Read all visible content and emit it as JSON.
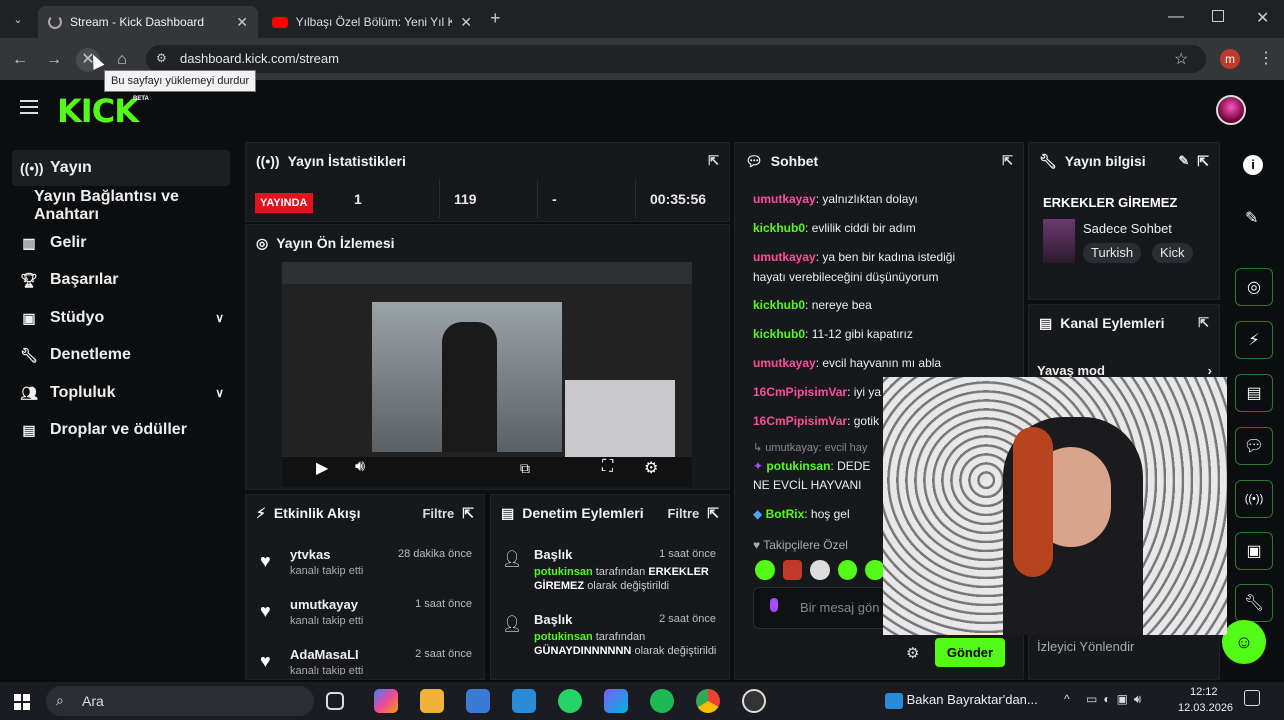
{
  "browser": {
    "tabs": [
      {
        "label": "Stream - Kick Dashboard"
      },
      {
        "label": "Yılbaşı Özel Bölüm: Yeni Yıl Kara"
      }
    ],
    "url": "dashboard.kick.com/stream",
    "tooltip": "Bu sayfayı yüklemeyi durdur",
    "profile_letter": "m"
  },
  "kick": {
    "logo": "KICK",
    "beta": "BETA"
  },
  "sidebar": {
    "items": [
      {
        "label": "Yayın",
        "icon": "broadcast-icon"
      },
      {
        "label": "Yayın Bağlantısı ve Anahtarı"
      },
      {
        "label": "Gelir",
        "icon": "revenue-icon"
      },
      {
        "label": "Başarılar",
        "icon": "trophy-icon"
      },
      {
        "label": "Stüdyo",
        "icon": "studio-icon"
      },
      {
        "label": "Denetleme",
        "icon": "wrench-icon"
      },
      {
        "label": "Topluluk",
        "icon": "community-icon"
      },
      {
        "label": "Droplar ve ödüller",
        "icon": "drops-icon"
      }
    ]
  },
  "stats": {
    "title": "Yayın İstatistikleri",
    "live": "YAYINDA",
    "viewers": "1",
    "followers": "119",
    "dash": "-",
    "time": "00:35:56"
  },
  "preview": {
    "title": "Yayın Ön İzlemesi"
  },
  "activity": {
    "title": "Etkinlik Akışı",
    "filter": "Filtre",
    "items": [
      {
        "name": "ytvkas",
        "time": "28 dakika önce",
        "sub": "kanalı takip etti"
      },
      {
        "name": "umutkayay",
        "time": "1 saat önce",
        "sub": "kanalı takip etti"
      },
      {
        "name": "AdaMasaLI",
        "time": "2 saat önce",
        "sub": "kanalı takip etti"
      }
    ]
  },
  "moderation": {
    "title": "Denetim Eylemleri",
    "filter": "Filtre",
    "items": [
      {
        "name": "Başlık",
        "time": "1 saat önce",
        "user": "potukinsan",
        "mid": "tarafından",
        "value": "ERKEKLER GİREMEZ",
        "tail": "olarak değiştirildi"
      },
      {
        "name": "Başlık",
        "time": "2 saat önce",
        "user": "potukinsan",
        "mid": "tarafından",
        "value": "GÜNAYDINNNNNN",
        "tail": "olarak değiştirildi"
      }
    ]
  },
  "chat": {
    "title": "Sohbet",
    "messages": [
      {
        "user": "umutkayay",
        "text": "yalnızlıktan dolayı",
        "c": "u1"
      },
      {
        "user": "kickhub0",
        "text": "evlilik ciddi bir adım",
        "c": "u2"
      },
      {
        "user": "umutkayay",
        "text": "ya ben bir kadına istediği hayatı verebileceğini düşünüyorum",
        "c": "u1"
      },
      {
        "user": "kickhub0",
        "text": "nereye bea",
        "c": "u2"
      },
      {
        "user": "kickhub0",
        "text": "11-12 gibi kapatırız",
        "c": "u2"
      },
      {
        "user": "umutkayay",
        "text": "evcil hayvanın mı abla",
        "c": "u1"
      },
      {
        "user": "16CmPipisimVar",
        "text": "iyi ya",
        "c": "u1"
      },
      {
        "user": "16CmPipisimVar",
        "text": "gotik",
        "c": "u1"
      }
    ],
    "reply": "umutkayay: evcil hay",
    "pot_user": "potukinsan",
    "pot_text": "DEDE",
    "pot_line2": "NE EVCİL HAYVANI",
    "bot_user": "BotRix",
    "bot_text": "hoş gel",
    "followers_only": "Takipçilere Özel",
    "placeholder": "Bir mesaj gön",
    "send": "Gönder"
  },
  "info": {
    "title": "Yayın bilgisi",
    "stream_title": "ERKEKLER GİREMEZ",
    "category": "Sadece Sohbet",
    "tags": [
      "Turkish",
      "Kick"
    ]
  },
  "channel": {
    "title": "Kanal Eylemleri",
    "slow": "Yavaş mod",
    "raid": "İzleyici Yönlendir"
  },
  "taskbar": {
    "search": "Ara",
    "news": "Bakan Bayraktar'dan...",
    "time": "12:12",
    "date": "12.03.2026"
  }
}
